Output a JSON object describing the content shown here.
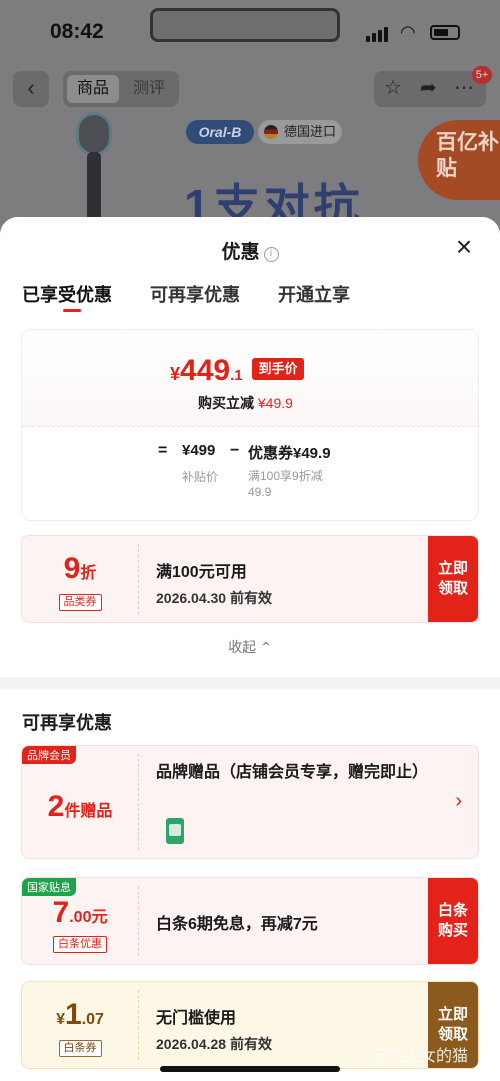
{
  "background": {
    "time": "08:42",
    "nav": {
      "tab_product": "商品",
      "tab_review": "测评",
      "badge": "5+"
    },
    "brand": "Oral-B",
    "import_label": "德国进口",
    "headline": "1支对抗",
    "subsidy": "百亿补贴"
  },
  "sheet": {
    "title": "优惠",
    "close_icon": "×",
    "tabs": [
      "已享受优惠",
      "可再享优惠",
      "开通立享"
    ],
    "price": {
      "currency": "¥",
      "integer": "449",
      "decimal": ".1",
      "final_tag": "到手价",
      "discount_text": "购买立减",
      "discount_amount": "¥49.9",
      "eq": "=",
      "base_price": "¥499",
      "base_label": "补贴价",
      "minus": "−",
      "coupon_price": "优惠券¥49.9",
      "coupon_label": "满100享9折减49.9"
    },
    "coupon_category": {
      "amount": "9",
      "unit": "折",
      "badge": "品类券",
      "line1": "满100元可用",
      "line2": "2026.04.30 前有效",
      "button": "立即领取"
    },
    "collapse_label": "收起 ⌃",
    "section_title": "可再享优惠",
    "coupon_gift": {
      "corner": "品牌会员",
      "amount": "2",
      "unit": "件赠品",
      "desc": "品牌赠品（店铺会员专享，赠完即止）",
      "chevron": "›"
    },
    "coupon_baitiao": {
      "corner": "国家贴息",
      "amount": "7",
      "unit": ".00元",
      "badge": "白条优惠",
      "line1": "白条6期免息，再减7元",
      "button": "白条购买"
    },
    "coupon_nothreshold": {
      "currency": "¥",
      "amount": "1",
      "decimal": ".07",
      "badge": "白条券",
      "line1": "无门槛使用",
      "line2": "2026.04.28 前有效",
      "button": "立即领取"
    }
  },
  "watermark": "元气少女的猫",
  "colors": {
    "accent": "#e2231a",
    "gold": "#8b5a1c",
    "green": "#1fa34a"
  }
}
